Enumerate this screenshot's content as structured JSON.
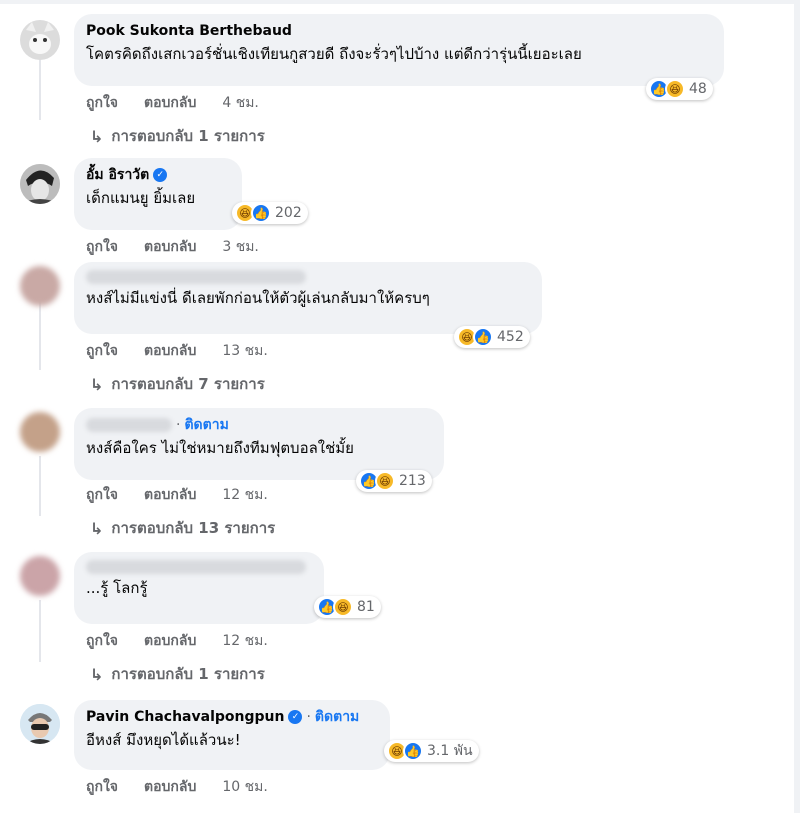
{
  "comments": [
    {
      "author": "Pook Sukonta Berthebaud",
      "text": "โคตรคิดถึงเสกเวอร์ชั่นเชิงเทียนกูสวยดี ถึงจะรั่วๆไปบ้าง แต่ดีกว่ารุ่นนี้เยอะเลย",
      "reaction_count": "48",
      "like_label": "ถูกใจ",
      "reply_label": "ตอบกลับ",
      "time": "4 ชม.",
      "replies_label": "การตอบกลับ 1 รายการ"
    },
    {
      "author": "อั้ม อิราวัต",
      "verified": true,
      "text": "เด็กแมนยู ยิ้มเลย",
      "reaction_count": "202",
      "like_label": "ถูกใจ",
      "reply_label": "ตอบกลับ",
      "time": "3 ชม."
    },
    {
      "text": "หงส์ไม่มีแข่งนี่ ดีเลยพักก่อนให้ตัวผู้เล่นกลับมาให้ครบๆ",
      "reaction_count": "452",
      "like_label": "ถูกใจ",
      "reply_label": "ตอบกลับ",
      "time": "13 ชม.",
      "replies_label": "การตอบกลับ 7 รายการ"
    },
    {
      "follow_label": "ติดตาม",
      "text": "หงส์คือใคร ไม่ใช่หมายถึงทีมฟุตบอลใช่มั้ย",
      "reaction_count": "213",
      "like_label": "ถูกใจ",
      "reply_label": "ตอบกลับ",
      "time": "12 ชม.",
      "replies_label": "การตอบกลับ 13 รายการ"
    },
    {
      "text": "...รู้ โลกรู้",
      "reaction_count": "81",
      "like_label": "ถูกใจ",
      "reply_label": "ตอบกลับ",
      "time": "12 ชม.",
      "replies_label": "การตอบกลับ 1 รายการ"
    },
    {
      "author": "Pavin Chachavalpongpun",
      "verified": true,
      "follow_label": "ติดตาม",
      "text": "อีหงส์ มึงหยุดได้แล้วนะ!",
      "reaction_count": "3.1 พัน",
      "like_label": "ถูกใจ",
      "reply_label": "ตอบกลับ",
      "time": "10 ชม."
    }
  ],
  "icons": {
    "like": "thumbs-up-icon",
    "haha": "laughing-face-icon",
    "reply_arrow": "reply-arrow-icon",
    "verified": "verified-badge-icon"
  },
  "colors": {
    "bubble": "#f0f2f5",
    "link": "#1877f2",
    "muted": "#65676b",
    "haha": "#f7b928"
  }
}
